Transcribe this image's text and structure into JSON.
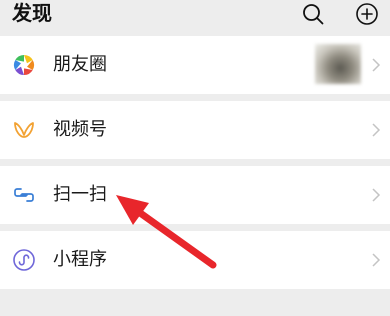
{
  "header": {
    "title": "发现",
    "search_icon": "search-icon",
    "add_icon": "plus-circle-icon"
  },
  "items": [
    {
      "label": "朋友圈",
      "icon": "moments-aperture-icon"
    },
    {
      "label": "视频号",
      "icon": "channels-icon"
    },
    {
      "label": "扫一扫",
      "icon": "scan-icon"
    },
    {
      "label": "小程序",
      "icon": "mini-program-icon"
    }
  ],
  "colors": {
    "background": "#ededed",
    "row_background": "#ffffff",
    "channels_orange": "#f2a233",
    "scan_blue": "#3a7fd6",
    "mini_program_purple": "#6f67d9",
    "annotation_red": "#e8262b"
  }
}
